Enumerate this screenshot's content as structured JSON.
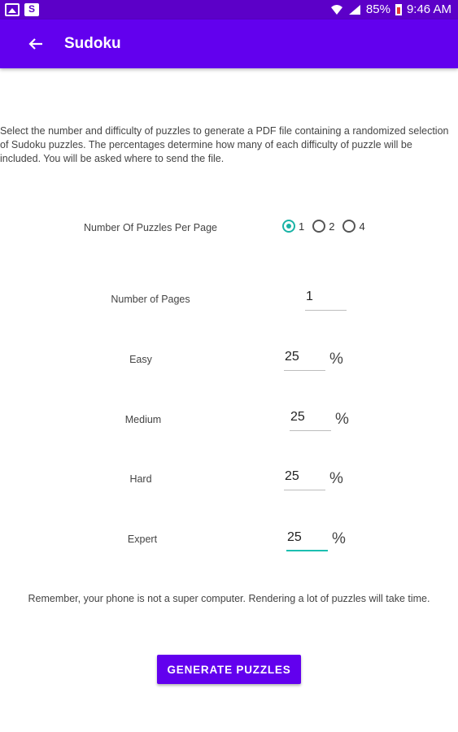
{
  "status_bar": {
    "battery": "85%",
    "time": "9:46 AM",
    "icons": [
      "image-icon",
      "message-icon",
      "wifi-icon",
      "signal-icon",
      "battery-icon"
    ]
  },
  "app_bar": {
    "title": "Sudoku",
    "back_icon": "arrow-back-icon"
  },
  "description": "Select the number and difficulty of puzzles to generate a PDF file containing a randomized selection of Sudoku puzzles.  The percentages determine how many of each difficulty of puzzle will be included.  You will be asked where to send the file.",
  "puzzles_per_page": {
    "label": "Number Of Puzzles Per Page",
    "options": [
      "1",
      "2",
      "4"
    ],
    "selected": "1"
  },
  "pages": {
    "label": "Number of Pages",
    "value": "1"
  },
  "difficulties": [
    {
      "label": "Easy",
      "value": "25",
      "unit": "%"
    },
    {
      "label": "Medium",
      "value": "25",
      "unit": "%"
    },
    {
      "label": "Hard",
      "value": "25",
      "unit": "%"
    },
    {
      "label": "Expert",
      "value": "25",
      "unit": "%"
    }
  ],
  "note": "Remember, your phone is not a super computer. Rendering a lot of puzzles will take time.",
  "generate_button": "GENERATE PUZZLES",
  "colors": {
    "primary": "#6200ee",
    "status_bar": "#5c00c8",
    "accent": "#19b3a6"
  }
}
